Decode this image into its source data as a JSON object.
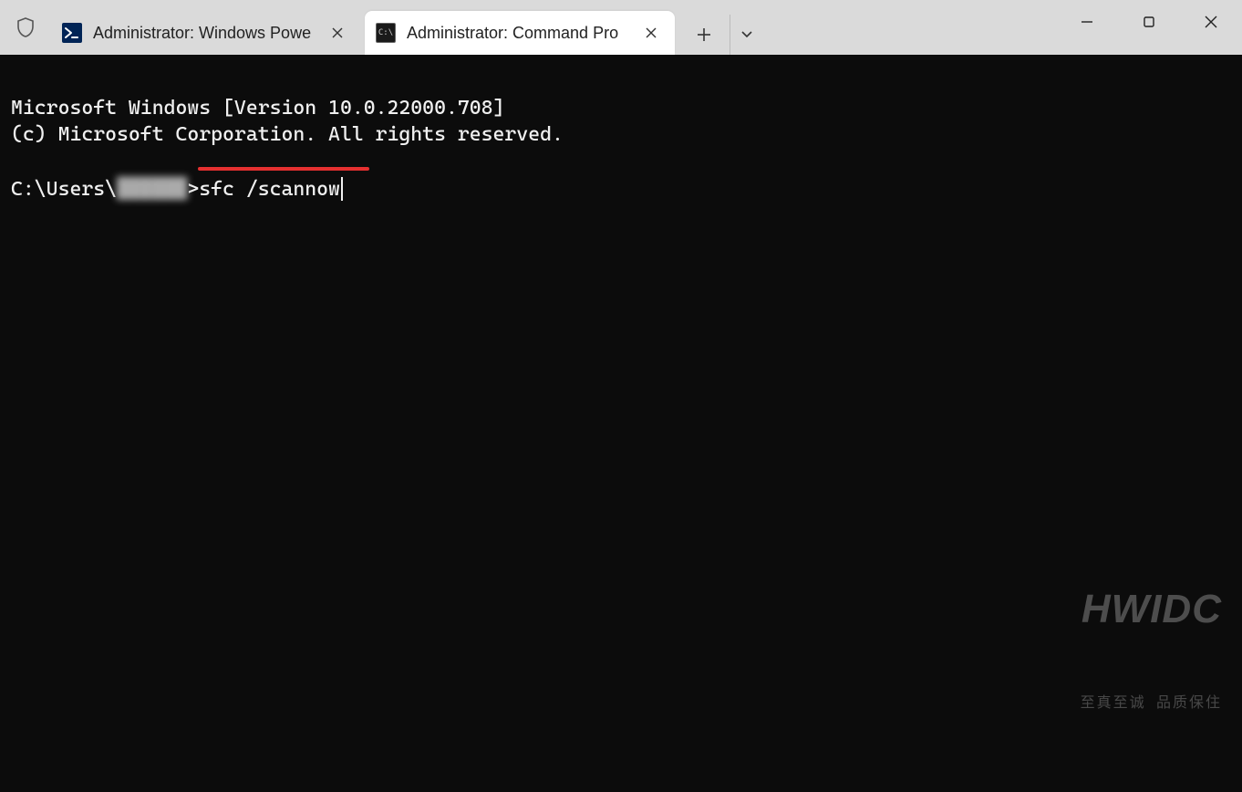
{
  "tabs": [
    {
      "title": "Administrator: Windows Powe",
      "active": false,
      "icon": "powershell-icon"
    },
    {
      "title": "Administrator: Command Pro",
      "active": true,
      "icon": "cmd-icon"
    }
  ],
  "terminal": {
    "header_line1": "Microsoft Windows [Version 10.0.22000.708]",
    "header_line2": "(c) Microsoft Corporation. All rights reserved.",
    "prompt_prefix": "C:\\Users\\",
    "prompt_user_blurred": "██████",
    "prompt_sep": ">",
    "command": "sfc /scannow"
  },
  "watermark": {
    "main": "HWIDC",
    "sub": "至真至诚 品质保住"
  }
}
